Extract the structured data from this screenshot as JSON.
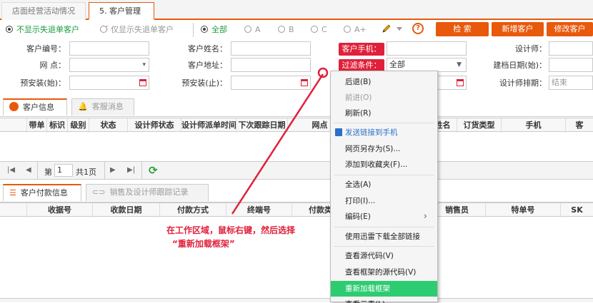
{
  "top_tabs": [
    {
      "label": "店面经营活动情况"
    },
    {
      "label": "5. 客户管理",
      "close": "×"
    }
  ],
  "filter_radios": {
    "group1": [
      {
        "label": "不显示失退单客户",
        "checked": true
      },
      {
        "label": "仅显示失退单客户",
        "checked": false
      }
    ],
    "group2": [
      {
        "label": "全部",
        "checked": true
      },
      {
        "label": "A",
        "checked": false
      },
      {
        "label": "B",
        "checked": false
      },
      {
        "label": "C",
        "checked": false
      },
      {
        "label": "A+",
        "checked": false
      }
    ]
  },
  "actions": {
    "search": "检 索",
    "add": "新增客户",
    "edit": "修改客户"
  },
  "form": {
    "customer_no": "客户编号：",
    "customer_name": "客户姓名：",
    "customer_phone": "客户手机：",
    "designer": "设计师：",
    "outlet": "网 点：",
    "customer_address": "客户地址：",
    "filter_condition": "过滤条件：",
    "filter_value": "全部",
    "archive_date": "建档日期(始)：",
    "install_start": "预安装(始)：",
    "install_end": "预安装(止)：",
    "designer_schedule": "设计师排期：",
    "designer_schedule_value": "结束"
  },
  "section1": {
    "tabs": [
      {
        "label": "客户信息"
      },
      {
        "label": "客服消息"
      }
    ],
    "columns": [
      "带单",
      "标识",
      "级别",
      "状态",
      "设计师状态",
      "设计师派单时间",
      "下次跟踪日期",
      "网点",
      "姓名",
      "订货类型",
      "手机",
      "客"
    ]
  },
  "pager": {
    "page_prefix": "第",
    "page_value": "1",
    "total": "共1页"
  },
  "section2": {
    "tabs": [
      {
        "label": "客户付款信息"
      },
      {
        "label": "销售及设计师跟踪记录"
      }
    ],
    "columns": [
      "收据号",
      "收款日期",
      "付款方式",
      "终端号",
      "付款类",
      "销售员",
      "特单号",
      "SK"
    ]
  },
  "annotation": {
    "line1": "在工作区域，鼠标右键，然后选择",
    "line2": "“重新加载框架”"
  },
  "context_menu": [
    {
      "label": "后退(B)",
      "state": "normal"
    },
    {
      "label": "前进(O)",
      "state": "disabled"
    },
    {
      "label": "刷新(R)",
      "state": "normal"
    },
    {
      "label": "发送链接到手机",
      "state": "blue"
    },
    {
      "label": "网页另存为(S)...",
      "state": "normal"
    },
    {
      "label": "添加到收藏夹(F)...",
      "state": "normal"
    },
    {
      "label": "全选(A)",
      "state": "normal"
    },
    {
      "label": "打印(I)...",
      "state": "normal"
    },
    {
      "label": "编码(E)",
      "state": "normal",
      "submenu": "›"
    },
    {
      "label": "使用迅雷下载全部链接",
      "state": "normal"
    },
    {
      "label": "查看源代码(V)",
      "state": "normal"
    },
    {
      "label": "查看框架的源代码(V)",
      "state": "normal"
    },
    {
      "label": "重新加载框架",
      "state": "highlighted"
    },
    {
      "label": "查看元素(L)",
      "state": "normal"
    }
  ],
  "colors": {
    "accent": "#e8590c",
    "label_red": "#e0213b",
    "highlight": "#2ecc71",
    "green_text": "#1a9e3a"
  }
}
